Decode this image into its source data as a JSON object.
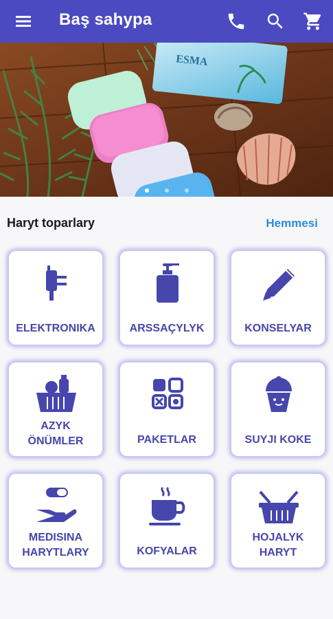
{
  "app_bar": {
    "title": "Baş sahypa",
    "icons": [
      "menu-icon",
      "phone-icon",
      "search-icon",
      "cart-icon"
    ],
    "color": "#4b4ac0"
  },
  "banner": {
    "brand_text": "ESMA",
    "slides_count": 3,
    "active_slide": 1
  },
  "section": {
    "title": "Haryt toparlary",
    "see_all": "Hemmesi"
  },
  "categories": [
    {
      "label": "ELEKTRONIKA",
      "icon": "plug-icon"
    },
    {
      "label": "ARSSAÇYLYK",
      "icon": "soap-dispenser-icon"
    },
    {
      "label": "KONSELYAR",
      "icon": "pencil-icon"
    },
    {
      "label": "AZYK\nÖNÜMLER",
      "icon": "food-basket-icon"
    },
    {
      "label": "PAKETLAR",
      "icon": "packages-grid-icon"
    },
    {
      "label": "SUYJI KOKE",
      "icon": "cupcake-icon"
    },
    {
      "label": "MEDISINA\nHARYTLARY",
      "icon": "hand-pill-icon"
    },
    {
      "label": "KOFYALAR",
      "icon": "coffee-cup-icon"
    },
    {
      "label": "HOJALYK\nHARYT",
      "icon": "shopping-basket-icon"
    }
  ],
  "colors": {
    "primary": "#4b4ac0",
    "icon": "#4646ad",
    "link": "#2b8cd6"
  }
}
